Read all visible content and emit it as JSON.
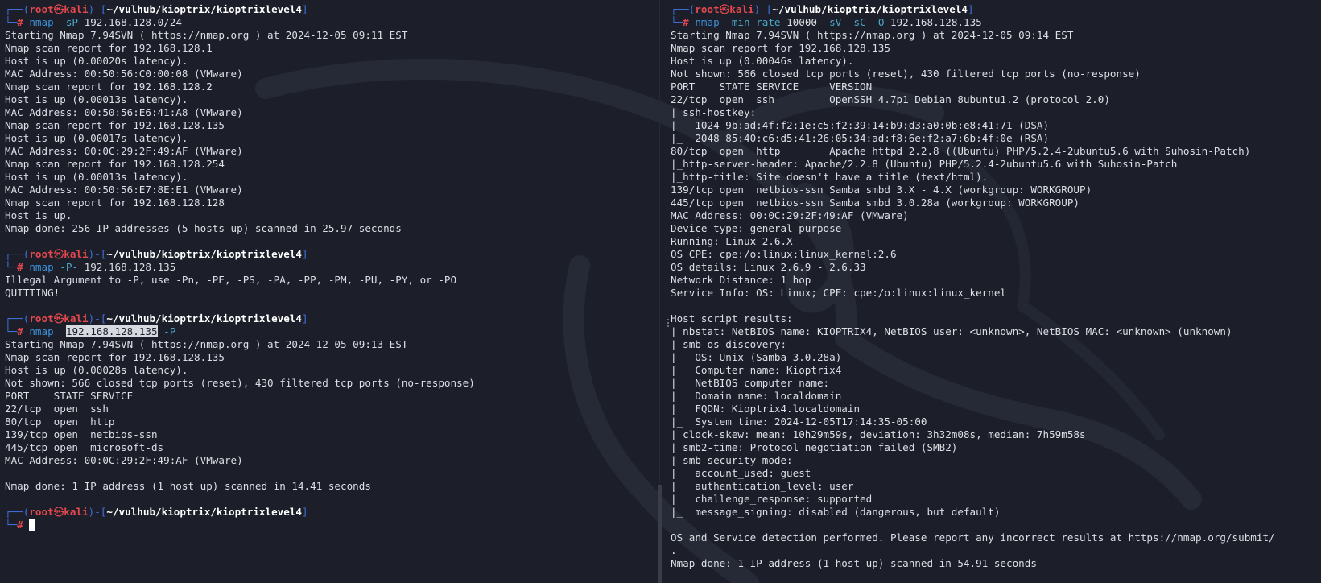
{
  "prompt": {
    "user": "root",
    "host": "kali",
    "path": "~/vulhub/kioptrix/kioptrixlevel4"
  },
  "left_pane": {
    "blocks": [
      {
        "command": {
          "program": "nmap",
          "args": " -sP",
          "target": " 192.168.128.0/24",
          "suffix": ""
        },
        "output": [
          "Starting Nmap 7.94SVN ( https://nmap.org ) at 2024-12-05 09:11 EST",
          "Nmap scan report for 192.168.128.1",
          "Host is up (0.00020s latency).",
          "MAC Address: 00:50:56:C0:00:08 (VMware)",
          "Nmap scan report for 192.168.128.2",
          "Host is up (0.00013s latency).",
          "MAC Address: 00:50:56:E6:41:A8 (VMware)",
          "Nmap scan report for 192.168.128.135",
          "Host is up (0.00017s latency).",
          "MAC Address: 00:0C:29:2F:49:AF (VMware)",
          "Nmap scan report for 192.168.128.254",
          "Host is up (0.00013s latency).",
          "MAC Address: 00:50:56:E7:8E:E1 (VMware)",
          "Nmap scan report for 192.168.128.128",
          "Host is up.",
          "Nmap done: 256 IP addresses (5 hosts up) scanned in 25.97 seconds",
          ""
        ]
      },
      {
        "command": {
          "program": "nmap",
          "args": " -P-",
          "target": " 192.168.128.135",
          "suffix": ""
        },
        "output": [
          "Illegal Argument to -P, use -Pn, -PE, -PS, -PA, -PP, -PM, -PU, -PY, or -PO",
          "QUITTING!",
          ""
        ]
      },
      {
        "command": {
          "program": "nmap",
          "args": "  ",
          "target": "192.168.128.135",
          "suffix": " -P"
        },
        "output": [
          "Starting Nmap 7.94SVN ( https://nmap.org ) at 2024-12-05 09:13 EST",
          "Nmap scan report for 192.168.128.135",
          "Host is up (0.00028s latency).",
          "Not shown: 566 closed tcp ports (reset), 430 filtered tcp ports (no-response)",
          "PORT    STATE SERVICE",
          "22/tcp  open  ssh",
          "80/tcp  open  http",
          "139/tcp open  netbios-ssn",
          "445/tcp open  microsoft-ds",
          "MAC Address: 00:0C:29:2F:49:AF (VMware)",
          "",
          "Nmap done: 1 IP address (1 host up) scanned in 14.41 seconds",
          ""
        ]
      }
    ]
  },
  "right_pane": {
    "command": {
      "program": "nmap",
      "args": " -min-rate",
      "rate": " 10000",
      "flags": " -sV -sC -O",
      "target": " 192.168.128.135"
    },
    "output": [
      "Starting Nmap 7.94SVN ( https://nmap.org ) at 2024-12-05 09:14 EST",
      "Nmap scan report for 192.168.128.135",
      "Host is up (0.00046s latency).",
      "Not shown: 566 closed tcp ports (reset), 430 filtered tcp ports (no-response)",
      "PORT    STATE SERVICE     VERSION",
      "22/tcp  open  ssh         OpenSSH 4.7p1 Debian 8ubuntu1.2 (protocol 2.0)",
      "| ssh-hostkey:",
      "|   1024 9b:ad:4f:f2:1e:c5:f2:39:14:b9:d3:a0:0b:e8:41:71 (DSA)",
      "|_  2048 85:40:c6:d5:41:26:05:34:ad:f8:6e:f2:a7:6b:4f:0e (RSA)",
      "80/tcp  open  http        Apache httpd 2.2.8 ((Ubuntu) PHP/5.2.4-2ubuntu5.6 with Suhosin-Patch)",
      "|_http-server-header: Apache/2.2.8 (Ubuntu) PHP/5.2.4-2ubuntu5.6 with Suhosin-Patch",
      "|_http-title: Site doesn't have a title (text/html).",
      "139/tcp open  netbios-ssn Samba smbd 3.X - 4.X (workgroup: WORKGROUP)",
      "445/tcp open  netbios-ssn Samba smbd 3.0.28a (workgroup: WORKGROUP)",
      "MAC Address: 00:0C:29:2F:49:AF (VMware)",
      "Device type: general purpose",
      "Running: Linux 2.6.X",
      "OS CPE: cpe:/o:linux:linux_kernel:2.6",
      "OS details: Linux 2.6.9 - 2.6.33",
      "Network Distance: 1 hop",
      "Service Info: OS: Linux; CPE: cpe:/o:linux:linux_kernel",
      "",
      "Host script results:",
      "|_nbstat: NetBIOS name: KIOPTRIX4, NetBIOS user: <unknown>, NetBIOS MAC: <unknown> (unknown)",
      "| smb-os-discovery:",
      "|   OS: Unix (Samba 3.0.28a)",
      "|   Computer name: Kioptrix4",
      "|   NetBIOS computer name:",
      "|   Domain name: localdomain",
      "|   FQDN: Kioptrix4.localdomain",
      "|_  System time: 2024-12-05T17:14:35-05:00",
      "|_clock-skew: mean: 10h29m59s, deviation: 3h32m08s, median: 7h59m58s",
      "|_smb2-time: Protocol negotiation failed (SMB2)",
      "| smb-security-mode:",
      "|   account_used: guest",
      "|   authentication_level: user",
      "|   challenge_response: supported",
      "|_  message_signing: disabled (dangerous, but default)",
      "",
      "OS and Service detection performed. Please report any incorrect results at https://nmap.org/submit/",
      ".",
      "Nmap done: 1 IP address (1 host up) scanned in 54.91 seconds"
    ]
  },
  "icons": {
    "skull": "skull-icon",
    "cursor": "cursor-block"
  },
  "colors": {
    "background": "#1c1f2a",
    "prompt_frame": "#3f6fd8",
    "prompt_user": "#e5484d",
    "command": "#3d8fd6",
    "flags": "#4aa8c9",
    "text": "#dcdfe4"
  }
}
